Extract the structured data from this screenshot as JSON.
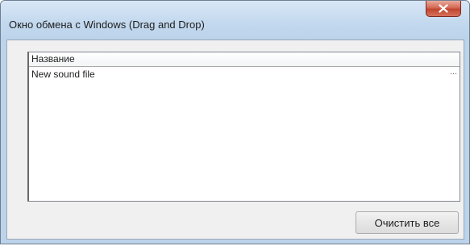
{
  "window": {
    "title": "Окно обмена с Windows (Drag and Drop)",
    "close_icon": "close-icon"
  },
  "list": {
    "columns": [
      "Название"
    ],
    "rows": [
      {
        "name": "New sound file",
        "more": "..."
      }
    ]
  },
  "actions": {
    "clear_all_label": "Очистить все"
  },
  "colors": {
    "frame": "#bcd3ea",
    "close_button": "#c04530",
    "client_bg": "#f0f0f0"
  }
}
